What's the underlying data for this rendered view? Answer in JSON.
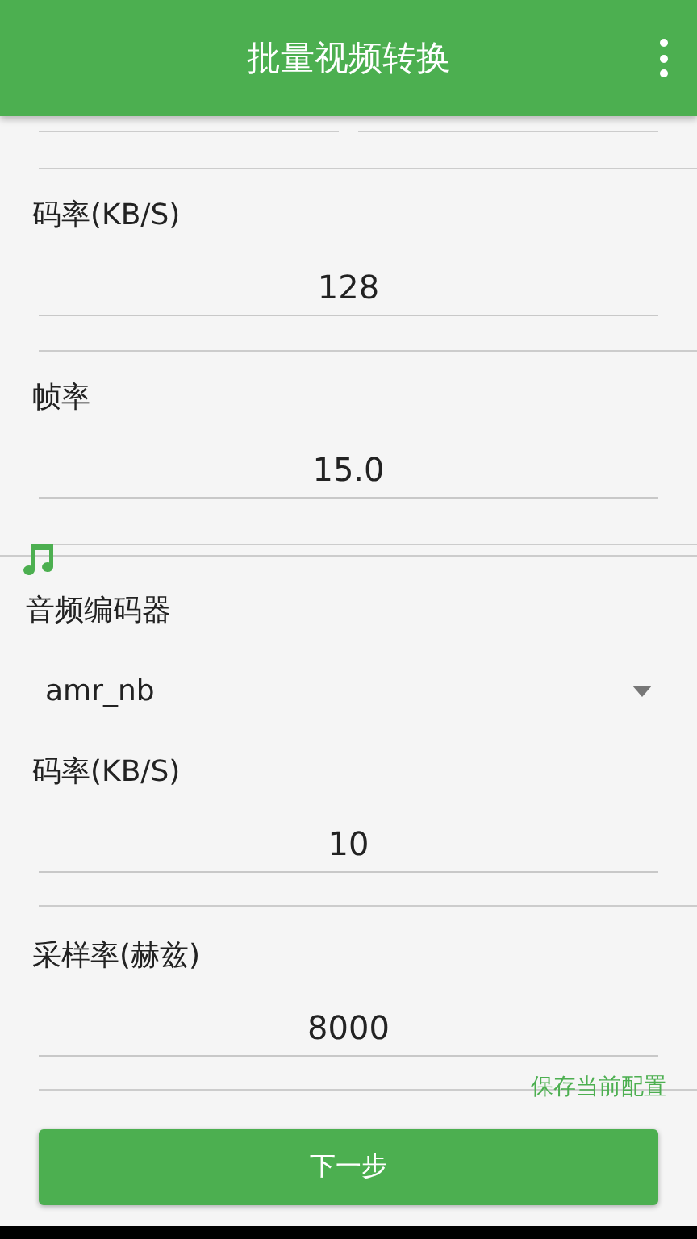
{
  "app_bar": {
    "title": "批量视频转换"
  },
  "video_fields": [
    {
      "label": "码率(KB/S)",
      "value": "128"
    },
    {
      "label": "帧率",
      "value": "15.0"
    }
  ],
  "audio": {
    "codec_label": "音频编码器",
    "codec_value": "amr_nb",
    "fields": [
      {
        "label": "码率(KB/S)",
        "value": "10"
      },
      {
        "label": "采样率(赫兹)",
        "value": "8000"
      }
    ]
  },
  "save_link": "保存当前配置",
  "next_button": "下一步"
}
